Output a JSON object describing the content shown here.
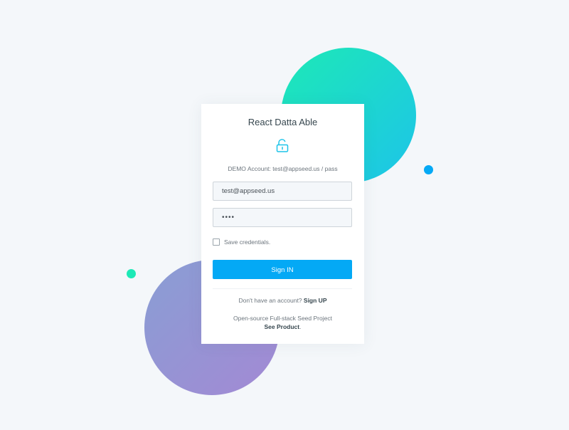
{
  "colors": {
    "background": "#f4f7fa",
    "accent": "#04a9f5",
    "teal": "#1de9b6",
    "purple": "#a389d4"
  },
  "card": {
    "title": "React Datta Able",
    "lock_icon": "unlock-icon",
    "demo_text": "DEMO Account: test@appseed.us / pass"
  },
  "form": {
    "email_value": "test@appseed.us",
    "password_value": "••••",
    "remember_label": "Save credentials.",
    "remember_checked": false,
    "submit_label": "Sign IN"
  },
  "footer": {
    "no_account_text": "Don't have an account?",
    "signup_label": "Sign UP",
    "seed_text": "Open-source Full-stack Seed Project",
    "product_label": "See Product",
    "product_suffix": "."
  }
}
